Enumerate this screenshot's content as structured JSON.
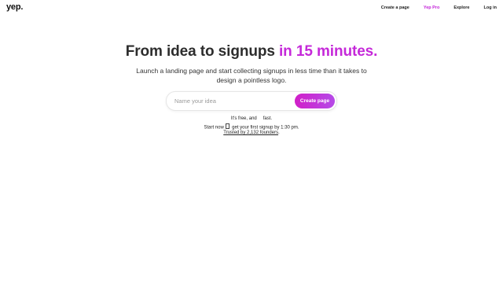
{
  "header": {
    "logo_text": "yep.",
    "nav": {
      "create_page": "Create a page",
      "yep_pro": "Yep Pro",
      "explore": "Explore",
      "login": "Log in"
    },
    "pro_color": "#c21fd8"
  },
  "hero": {
    "title_main": "From idea to signups ",
    "title_accent": "in 15 minutes.",
    "subtitle": "Launch a landing page and start collecting signups in less time than it takes to design a pointless logo."
  },
  "form": {
    "placeholder": "Name your idea",
    "value": "",
    "button_label": "Create page"
  },
  "notes": {
    "line1_a": "It's free, and",
    "line1_b": "fast.",
    "line2_a": "Start now",
    "line2_b": "get your first signup by 1:30 pm.",
    "line3": "Trusted by 2,132 founders"
  },
  "colors": {
    "accent": "#c529d9",
    "button_gradient_start": "#d11fc8",
    "button_gradient_end": "#b54ae8"
  }
}
